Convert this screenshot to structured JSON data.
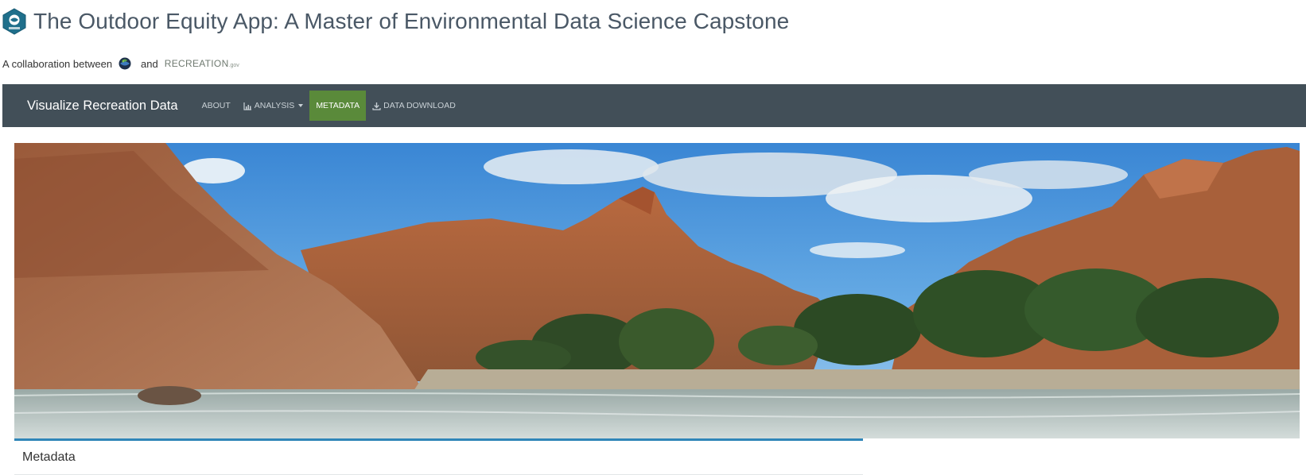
{
  "header": {
    "title": "The Outdoor Equity App: A Master of Environmental Data Science Capstone",
    "logo_icon": "hex-logo-icon"
  },
  "collaboration": {
    "prefix": "A collaboration between",
    "conjunction": "and",
    "partner_logo_text": "RECREATION",
    "partner_logo_suffix": ".gov"
  },
  "navbar": {
    "brand": "Visualize Recreation Data",
    "items": [
      {
        "label": "ABOUT",
        "icon": "",
        "active": false
      },
      {
        "label": "ANALYSIS",
        "icon": "bar-chart-icon",
        "active": false,
        "dropdown": true
      },
      {
        "label": "METADATA",
        "icon": "",
        "active": true
      },
      {
        "label": "DATA DOWNLOAD",
        "icon": "download-icon",
        "active": false
      }
    ]
  },
  "banner": {
    "description_icon": "canyon-river-landscape-image"
  },
  "metadata_panel": {
    "title": "Metadata"
  },
  "colors": {
    "navbar_bg": "#424f58",
    "active_tab": "#5a8a3a",
    "panel_accent": "#2f86b8",
    "title_text": "#4a5866"
  }
}
